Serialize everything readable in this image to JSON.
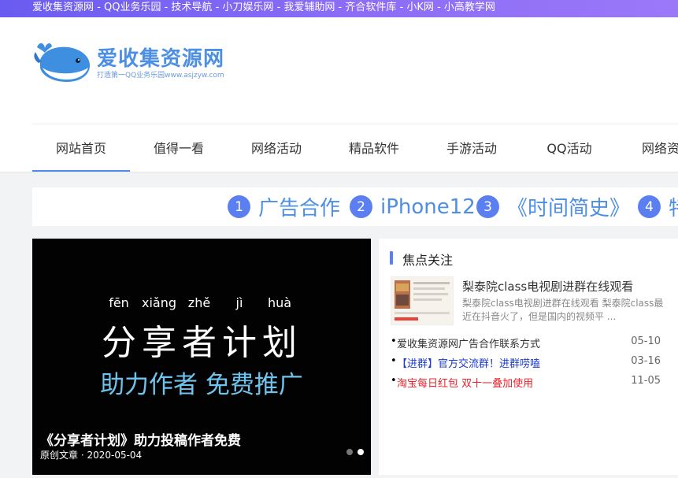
{
  "topbar": {
    "links": [
      "爱收集资源网",
      "QQ业务乐园",
      "技术导航",
      "小刀娱乐网",
      "我爱辅助网",
      "齐合软件库",
      "小K网",
      "小高教学网"
    ],
    "separator": " - "
  },
  "logo": {
    "title": "爱收集资源网",
    "subtitle": "打造第一QQ业务乐园www.asjzyw.com"
  },
  "nav": {
    "items": [
      "网站首页",
      "值得一看",
      "网络活动",
      "精品软件",
      "手游活动",
      "QQ活动",
      "网络资源"
    ],
    "active_index": 0
  },
  "ticker": {
    "items": [
      {
        "num": "1",
        "text": "广告合作"
      },
      {
        "num": "2",
        "text": "iPhone12"
      },
      {
        "num": "3",
        "text": "《时间简史》"
      },
      {
        "num": "4",
        "text": "特"
      }
    ]
  },
  "slider": {
    "pinyin": [
      "fēn",
      "xiǎng",
      "zhě",
      "jì",
      "huà"
    ],
    "hanzi": [
      "分",
      "享",
      "者",
      "计",
      "划"
    ],
    "subtitle": "助力作者 免费推广",
    "caption": "《分享者计划》助力投稿作者免费",
    "meta": "原创文章 · 2020-05-04",
    "active_dot": 1
  },
  "focus": {
    "heading": "焦点关注",
    "featured_title": "梨泰院class电视剧进群在线观看",
    "featured_desc": "梨泰院class电视剧进群在线观看 梨泰院class最近在抖音火了，但是国内的视频平 ...",
    "list": [
      {
        "bullet": "•",
        "text": "爱收集资源网广告合作联系方式",
        "date": "05-10",
        "color": "#333333"
      },
      {
        "bullet": "•",
        "text": "【进群】官方交流群！进群唠嗑",
        "date": "03-16",
        "color": "#1a3bd1"
      },
      {
        "bullet": "•",
        "text": "淘宝每日红包 双十一叠加使用",
        "date": "11-05",
        "color": "#e8232d"
      }
    ]
  },
  "colors": {
    "accent": "#4d8fe5",
    "ticker_badge": "#5b7ff0",
    "topbar_from": "#6a5cf0",
    "topbar_to": "#9b78f8",
    "slide_subtitle": "#6fc4ee"
  }
}
